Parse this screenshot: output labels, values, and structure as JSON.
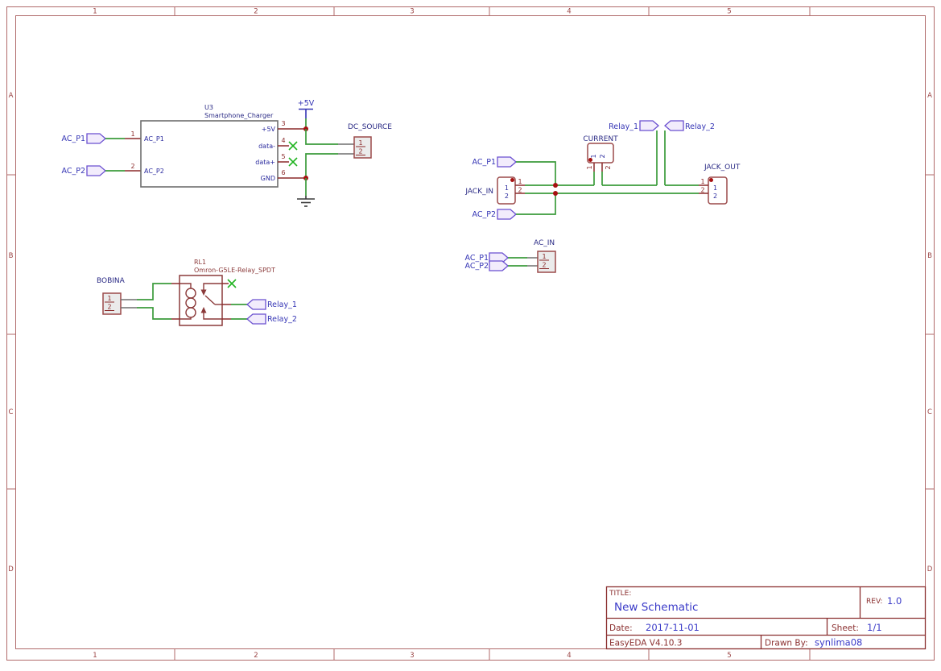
{
  "colors": {
    "wire_green": "#3B9B3B",
    "pin_dark_red": "#8B2A2A",
    "component_outline": "#9B4A4A",
    "frame_rose": "#B06A6A",
    "title_block_red": "#8B3030",
    "net_text_blue": "#3535B5",
    "value_text_blue": "#3A3AC8",
    "junction_red": "#A61111",
    "no_connect_green": "#22B422",
    "flag_fill": "#F2ECFC",
    "flag_border": "#6A4FD0"
  },
  "frame": {
    "columns": [
      "1",
      "2",
      "3",
      "4",
      "5"
    ],
    "rows": [
      "A",
      "B",
      "C",
      "D"
    ]
  },
  "title_block": {
    "title_label": "TITLE:",
    "title": "New Schematic",
    "rev_label": "REV:",
    "rev": "1.0",
    "date_label": "Date:",
    "date": "2017-11-01",
    "sheet_label": "Sheet:",
    "sheet": "1/1",
    "tool_version": "EasyEDA V4.10.3",
    "drawn_by_label": "Drawn By:",
    "drawn_by": "synlima08"
  },
  "nets": {
    "ac_p1": "AC_P1",
    "ac_p2": "AC_P2",
    "relay_1": "Relay_1",
    "relay_2": "Relay_2",
    "plus_5v": "+5V"
  },
  "components": {
    "u3": {
      "ref": "U3",
      "value": "Smartphone_Charger",
      "left_pins": [
        {
          "num": "1",
          "name": "AC_P1"
        },
        {
          "num": "2",
          "name": "AC_P2"
        }
      ],
      "right_pins": [
        {
          "num": "3",
          "name": "+5V"
        },
        {
          "num": "4",
          "name": "data-"
        },
        {
          "num": "5",
          "name": "data+"
        },
        {
          "num": "6",
          "name": "GND"
        }
      ]
    },
    "dc_source": {
      "name": "DC_SOURCE",
      "pins": [
        "1",
        "2"
      ]
    },
    "jack_in": {
      "name": "JACK_IN",
      "pin_numbers": [
        "1",
        "2"
      ],
      "pin_names": [
        "1",
        "2"
      ]
    },
    "jack_out": {
      "name": "JACK_OUT",
      "pin_numbers": [
        "1",
        "2"
      ],
      "pin_names": [
        "1",
        "2"
      ]
    },
    "current": {
      "name": "CURRENT",
      "pin_numbers": [
        "1",
        "2"
      ],
      "pin_names": [
        "1",
        "2"
      ]
    },
    "ac_in": {
      "name": "AC_IN",
      "pins": [
        "1",
        "2"
      ]
    },
    "bobina": {
      "name": "BOBINA",
      "pins": [
        "1",
        "2"
      ]
    },
    "rl1": {
      "ref": "RL1",
      "value": "Omron-G5LE-Relay_SPDT"
    }
  }
}
